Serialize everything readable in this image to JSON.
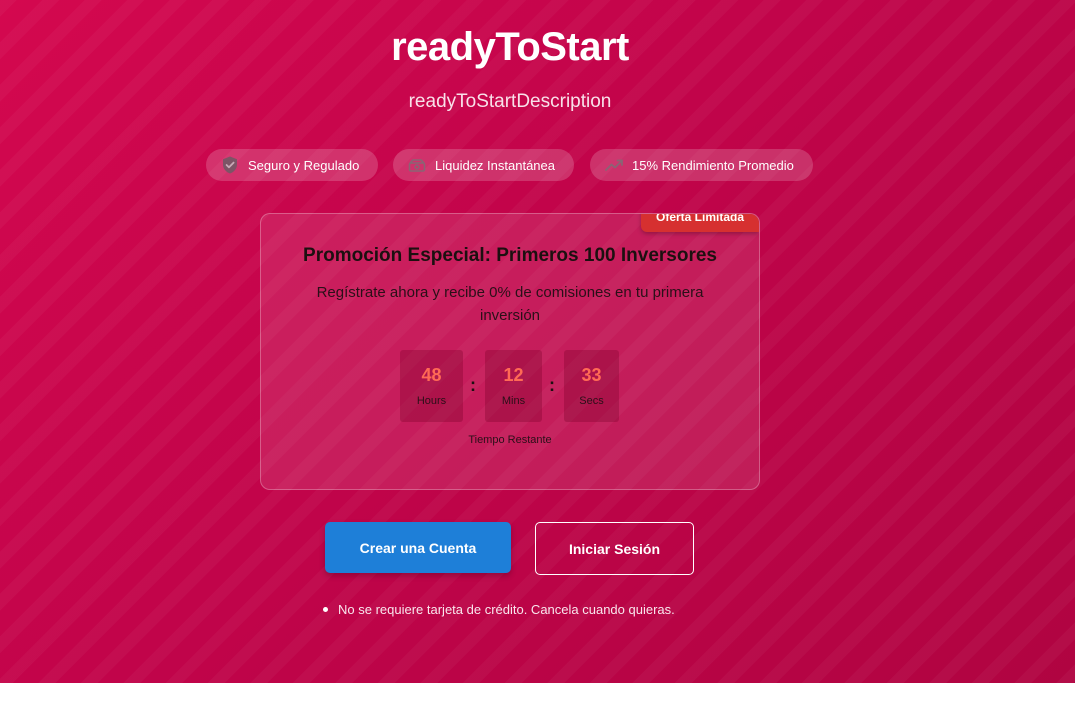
{
  "hero": {
    "title": "readyToStart",
    "subtitle": "readyToStartDescription"
  },
  "badges": [
    {
      "icon": "shield-check-icon",
      "label": "Seguro y Regulado"
    },
    {
      "icon": "cash-stack-icon",
      "label": "Liquidez Instantánea"
    },
    {
      "icon": "trending-up-icon",
      "label": "15% Rendimiento Promedio"
    }
  ],
  "promo": {
    "ribbon": "Oferta Limitada",
    "title": "Promoción Especial: Primeros 100 Inversores",
    "description": "Regístrate ahora y recibe 0% de comisiones en tu primera inversión",
    "countdown": {
      "hours": "48",
      "hours_label": "Hours",
      "minutes": "12",
      "minutes_label": "Mins",
      "seconds": "33",
      "seconds_label": "Secs",
      "separator": ":",
      "caption": "Tiempo Restante"
    }
  },
  "actions": {
    "primary_label": "Crear una Cuenta",
    "secondary_label": "Iniciar Sesión"
  },
  "note": "No se requiere tarjeta de crédito. Cancela cuando quieras.",
  "colors": {
    "hero_background": "#c1044a",
    "primary_button": "#1e7fd8",
    "ribbon": "#d63030",
    "countdown_number": "#ff6a55"
  }
}
